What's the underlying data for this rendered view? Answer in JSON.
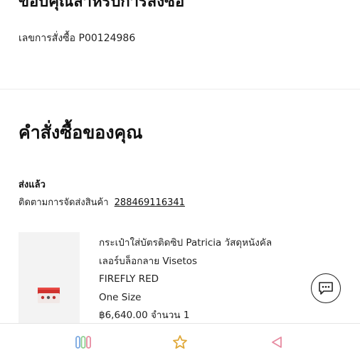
{
  "header": {
    "title_partial": "ขอบคุณสำหรับการสั่งซื้อ",
    "order_number_text": "เลขการสั่งซื้อ P00124986"
  },
  "orders": {
    "section_title": "คำสั่งซื้อของคุณ",
    "status": "ส่งแล้ว",
    "tracking_label": "ติดตามการจัดส่งสินค้า",
    "tracking_number": "288469116341"
  },
  "product": {
    "name_line1": "กระเป๋าใส่บัตรติดซิป Patricia วัสดุหนังคัล",
    "name_line2": "เลอร์บล็อกลาย Visetos",
    "color": "FIREFLY RED",
    "size": "One Size",
    "price_qty": "฿6,640.00 จำนวน 1"
  },
  "icons": {
    "chat": "chat-bubble-icon",
    "nav_recents": "recents-icon",
    "nav_home": "home-star-icon",
    "nav_back": "back-triangle-icon"
  },
  "colors": {
    "accent_red": "#d0312d",
    "nav_blue": "#7aa7e0",
    "nav_green": "#8ccf8f",
    "nav_pink": "#e78aa0",
    "nav_yellow": "#f2c94c"
  }
}
